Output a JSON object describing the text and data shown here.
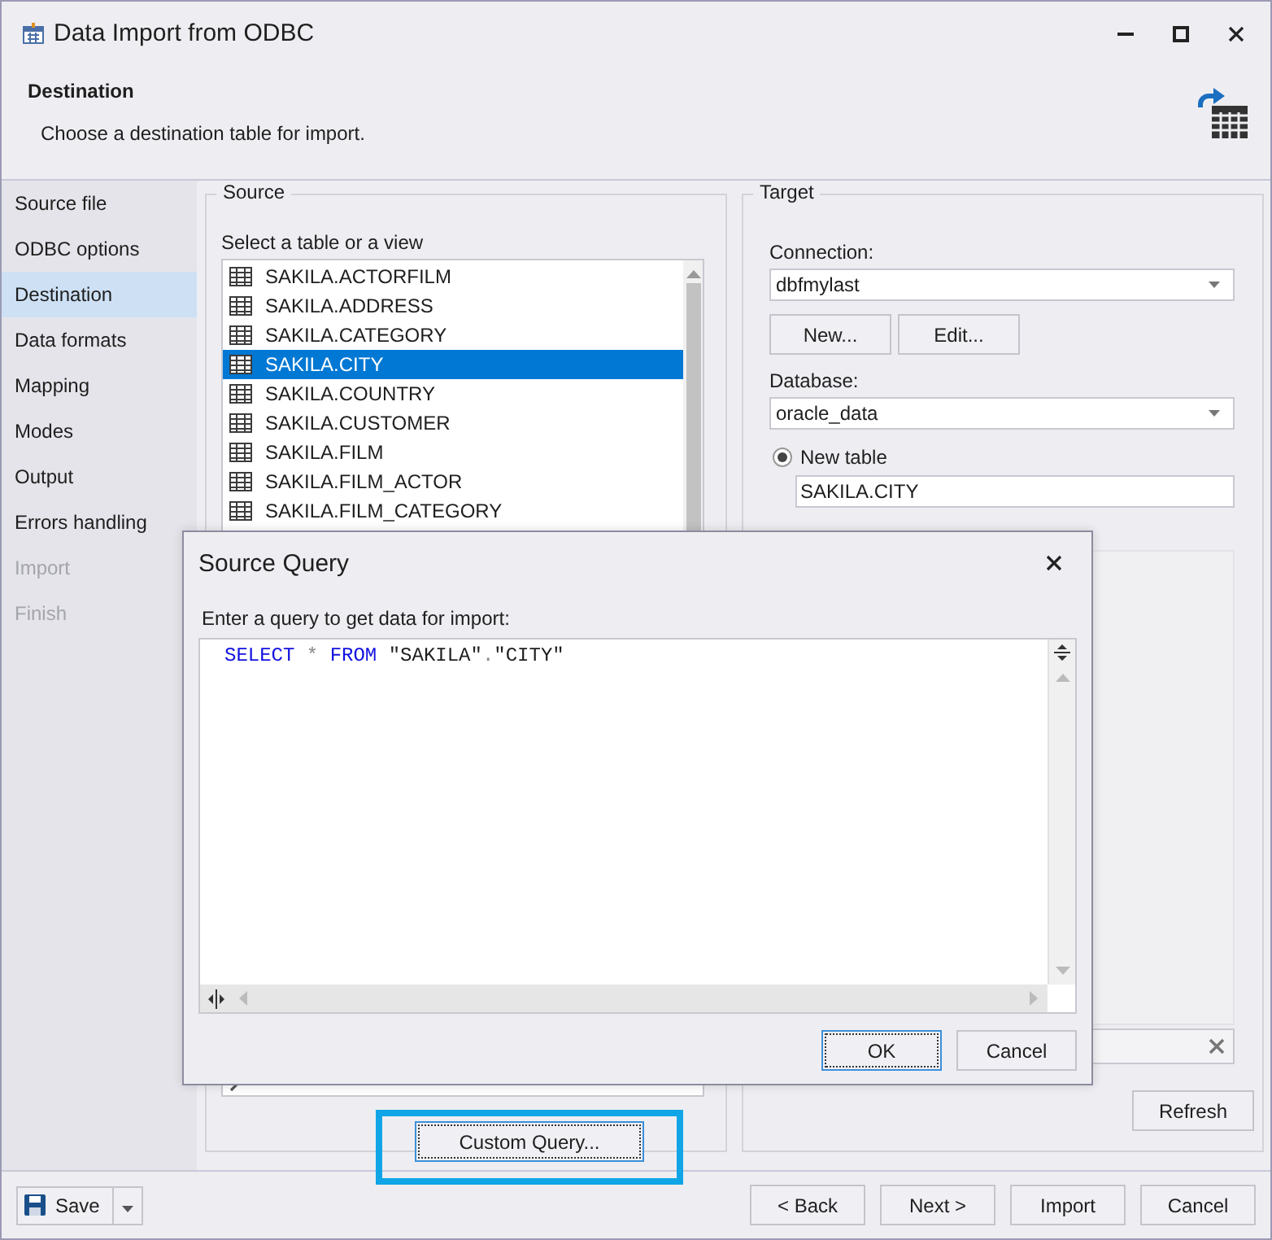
{
  "window": {
    "title": "Data Import from ODBC"
  },
  "header": {
    "title": "Destination",
    "description": "Choose a destination table for import."
  },
  "sidebar": {
    "items": [
      {
        "label": "Source file",
        "selected": false,
        "disabled": false
      },
      {
        "label": "ODBC options",
        "selected": false,
        "disabled": false
      },
      {
        "label": "Destination",
        "selected": true,
        "disabled": false
      },
      {
        "label": "Data formats",
        "selected": false,
        "disabled": false
      },
      {
        "label": "Mapping",
        "selected": false,
        "disabled": false
      },
      {
        "label": "Modes",
        "selected": false,
        "disabled": false
      },
      {
        "label": "Output",
        "selected": false,
        "disabled": false
      },
      {
        "label": "Errors handling",
        "selected": false,
        "disabled": false
      },
      {
        "label": "Import",
        "selected": false,
        "disabled": true
      },
      {
        "label": "Finish",
        "selected": false,
        "disabled": true
      }
    ]
  },
  "source": {
    "title": "Source",
    "list_label": "Select a table or a view",
    "tables": [
      {
        "name": "SAKILA.ACTORFILM",
        "selected": false
      },
      {
        "name": "SAKILA.ADDRESS",
        "selected": false
      },
      {
        "name": "SAKILA.CATEGORY",
        "selected": false
      },
      {
        "name": "SAKILA.CITY",
        "selected": true
      },
      {
        "name": "SAKILA.COUNTRY",
        "selected": false
      },
      {
        "name": "SAKILA.CUSTOMER",
        "selected": false
      },
      {
        "name": "SAKILA.FILM",
        "selected": false
      },
      {
        "name": "SAKILA.FILM_ACTOR",
        "selected": false
      },
      {
        "name": "SAKILA.FILM_CATEGORY",
        "selected": false
      }
    ],
    "custom_query_button": {
      "label": "Custom Query...",
      "highlighted": true
    }
  },
  "target": {
    "title": "Target",
    "connection_label": "Connection:",
    "connection": "dbfmylast",
    "new_button": "New...",
    "edit_button": "Edit...",
    "database_label": "Database:",
    "database": "oracle_data",
    "new_table": {
      "label": "New table",
      "selected": true
    },
    "table_name": "SAKILA.CITY",
    "refresh_button": "Refresh"
  },
  "dialog": {
    "title": "Source Query",
    "prompt": "Enter a query to get data for import:",
    "query": [
      {
        "text": "SELECT ",
        "kind": "keyword"
      },
      {
        "text": "* ",
        "kind": "operator"
      },
      {
        "text": "FROM ",
        "kind": "keyword"
      },
      {
        "text": "\"SAKILA\"",
        "kind": "string"
      },
      {
        "text": ".",
        "kind": "operator"
      },
      {
        "text": "\"CITY\"",
        "kind": "string"
      }
    ],
    "buttons": [
      {
        "label": "OK",
        "default": true
      },
      {
        "label": "Cancel",
        "default": false
      }
    ]
  },
  "footer": {
    "save_button": "Save",
    "buttons": [
      "< Back",
      "Next >",
      "Import",
      "Cancel"
    ]
  }
}
